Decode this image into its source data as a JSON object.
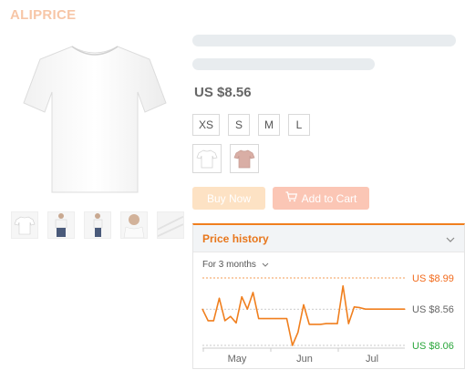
{
  "brand": {
    "logo_text": "ALIPRICE"
  },
  "product": {
    "price": "US $8.56",
    "sizes": [
      "XS",
      "S",
      "M",
      "L"
    ],
    "color_options": [
      "white",
      "pink"
    ],
    "thumbnails": [
      "front-shirt",
      "model-front",
      "model-side",
      "model-closeup",
      "fabric-detail"
    ]
  },
  "actions": {
    "buy_now_label": "Buy Now",
    "add_to_cart_label": "Add to Cart"
  },
  "price_history": {
    "title": "Price history",
    "range_label": "For 3 months",
    "max_label": "US $8.99",
    "current_label": "US $8.56",
    "min_label": "US $8.06"
  },
  "colors": {
    "accent": "#f07f1e",
    "max_price": "#f26b1d",
    "min_price": "#2aa63b",
    "buy_now": "#fde2c4",
    "add_to_cart": "#fbc6b5",
    "skeleton": "#e8ecef"
  },
  "chart_data": {
    "type": "line",
    "x": [
      0,
      1,
      2,
      3,
      4,
      5,
      6,
      7,
      8,
      9,
      10,
      11,
      12,
      13,
      14,
      15,
      16,
      17,
      18,
      19,
      20,
      21,
      22,
      23,
      24,
      25,
      26,
      27,
      28,
      29,
      30,
      31,
      32,
      33,
      34,
      35,
      36
    ],
    "y": [
      8.56,
      8.4,
      8.4,
      8.71,
      8.4,
      8.46,
      8.37,
      8.73,
      8.56,
      8.79,
      8.43,
      8.43,
      8.43,
      8.43,
      8.43,
      8.43,
      8.06,
      8.24,
      8.62,
      8.35,
      8.35,
      8.35,
      8.36,
      8.36,
      8.36,
      8.88,
      8.36,
      8.59,
      8.58,
      8.56,
      8.56,
      8.56,
      8.56,
      8.56,
      8.56,
      8.56,
      8.56
    ],
    "xticks": [
      "May",
      "Jun",
      "Jul"
    ],
    "ylim": [
      8.06,
      8.99
    ],
    "legend": "none",
    "series_color": "#f07f1e"
  }
}
